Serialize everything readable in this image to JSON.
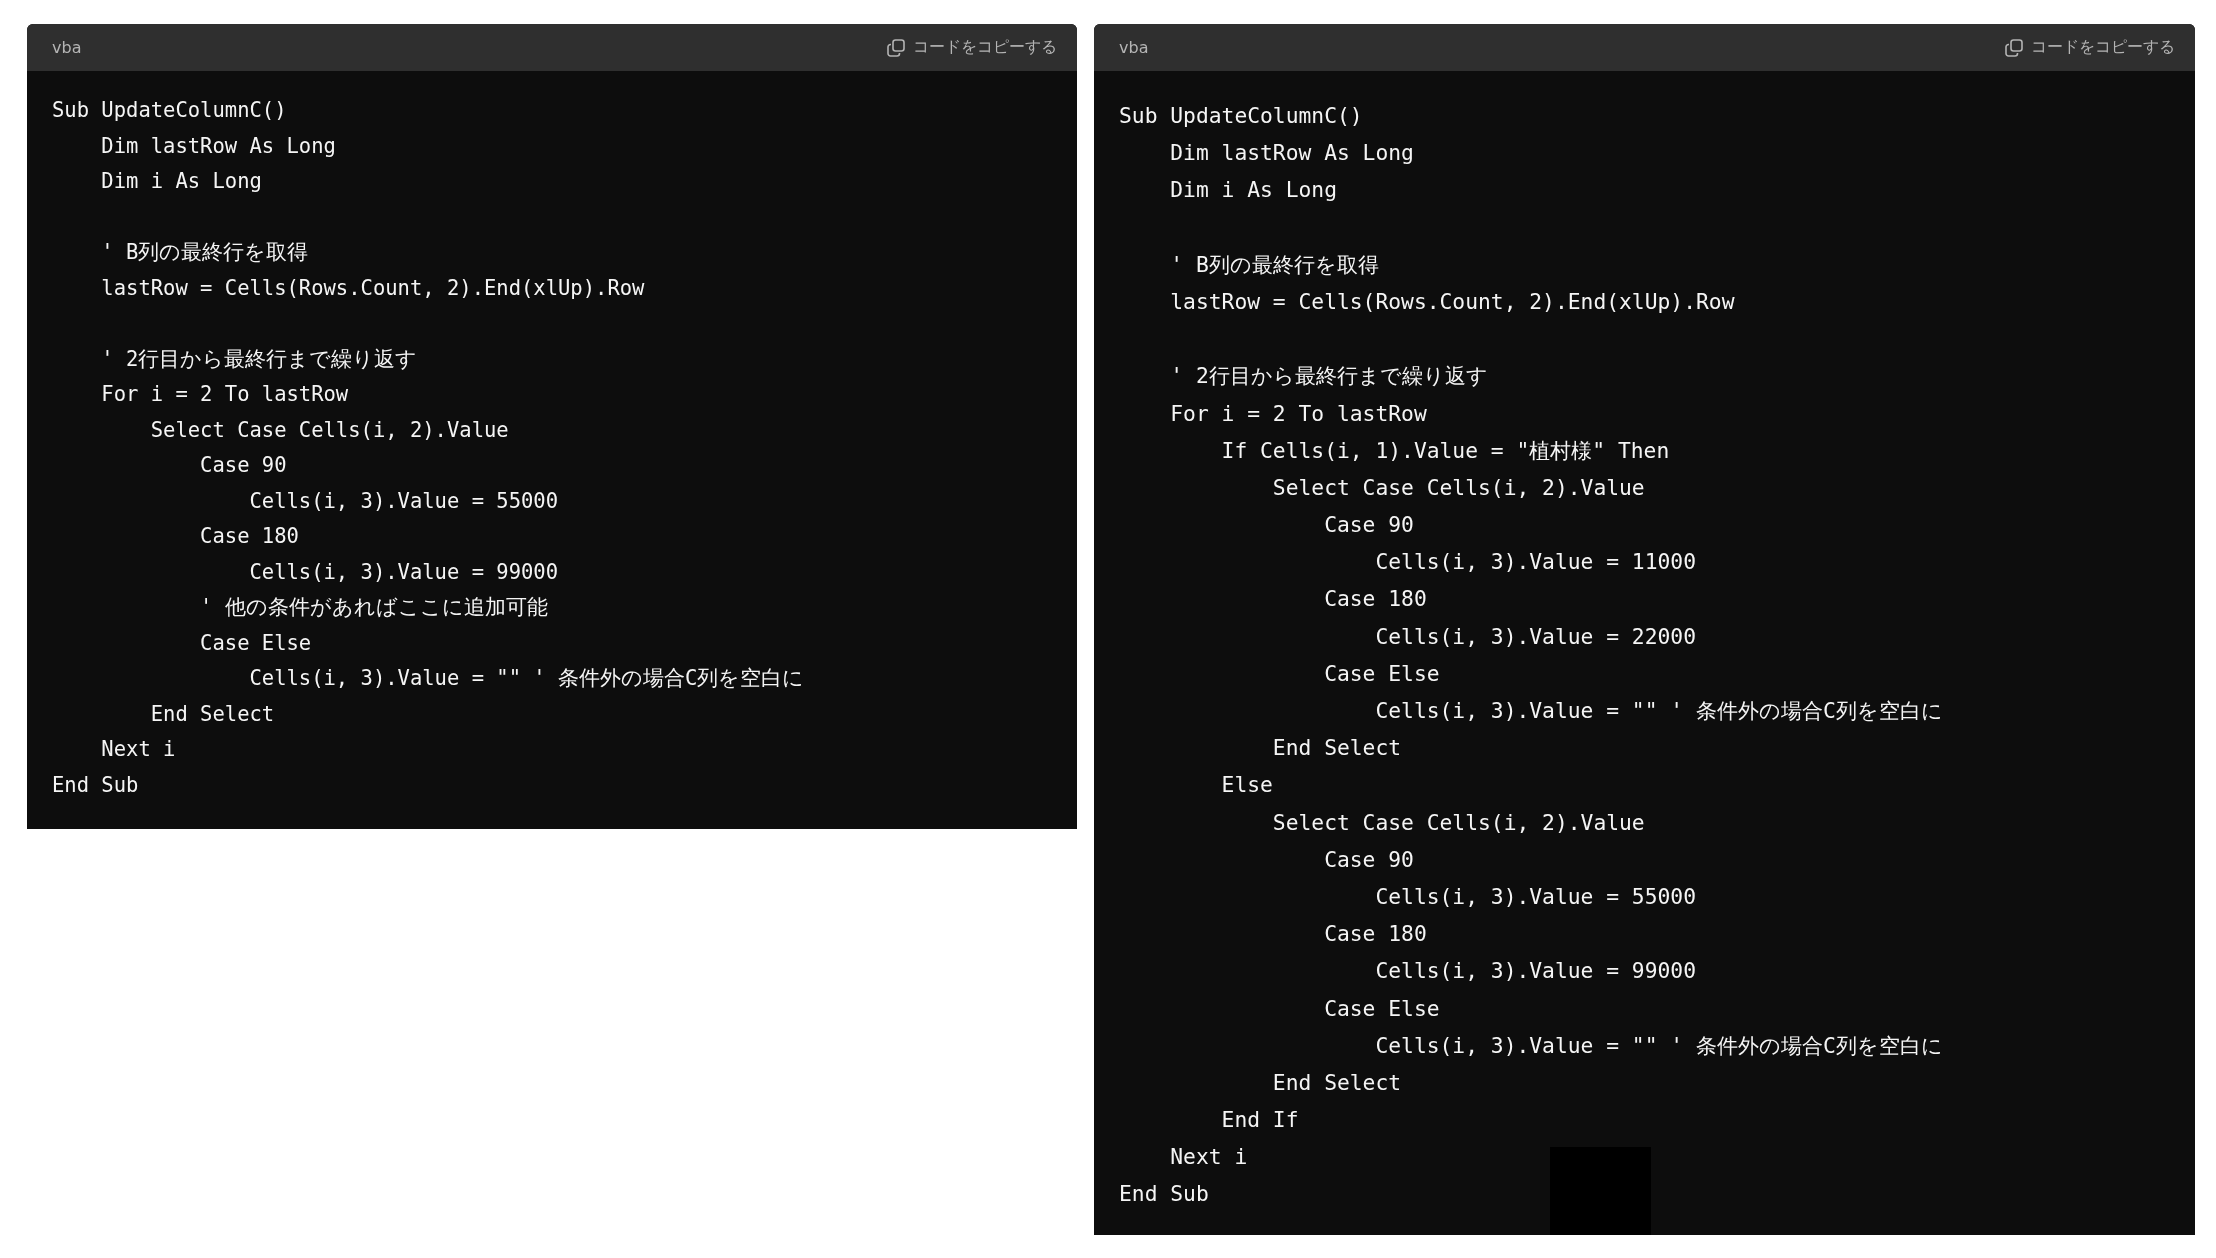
{
  "code_blocks": [
    {
      "language": "vba",
      "copy_label": "コードをコピーする",
      "redacted": false,
      "code": "Sub UpdateColumnC()\n    Dim lastRow As Long\n    Dim i As Long\n\n    ' B列の最終行を取得\n    lastRow = Cells(Rows.Count, 2).End(xlUp).Row\n\n    ' 2行目から最終行まで繰り返す\n    For i = 2 To lastRow\n        Select Case Cells(i, 2).Value\n            Case 90\n                Cells(i, 3).Value = 55000\n            Case 180\n                Cells(i, 3).Value = 99000\n            ' 他の条件があればここに追加可能\n            Case Else\n                Cells(i, 3).Value = \"\" ' 条件外の場合C列を空白に\n        End Select\n    Next i\nEnd Sub"
    },
    {
      "language": "vba",
      "copy_label": "コードをコピーする",
      "redacted": true,
      "code": "Sub UpdateColumnC()\n    Dim lastRow As Long\n    Dim i As Long\n\n    ' B列の最終行を取得\n    lastRow = Cells(Rows.Count, 2).End(xlUp).Row\n\n    ' 2行目から最終行まで繰り返す\n    For i = 2 To lastRow\n        If Cells(i, 1).Value = \"植村様\" Then\n            Select Case Cells(i, 2).Value\n                Case 90\n                    Cells(i, 3).Value = 11000\n                Case 180\n                    Cells(i, 3).Value = 22000\n                Case Else\n                    Cells(i, 3).Value = \"\" ' 条件外の場合C列を空白に\n            End Select\n        Else\n            Select Case Cells(i, 2).Value\n                Case 90\n                    Cells(i, 3).Value = 55000\n                Case 180\n                    Cells(i, 3).Value = 99000\n                Case Else\n                    Cells(i, 3).Value = \"\" ' 条件外の場合C列を空白に\n            End Select\n        End If\n    Next i\nEnd Sub"
    }
  ]
}
